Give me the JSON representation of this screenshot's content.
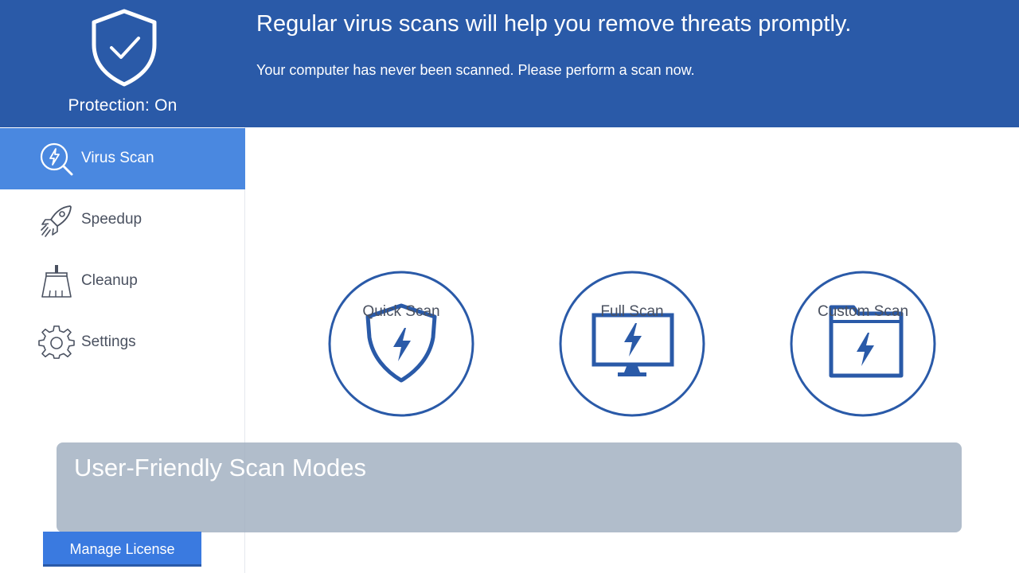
{
  "header": {
    "status_label": "Protection: On",
    "headline": "Regular virus scans will help you remove threats promptly.",
    "subline": "Your computer has never been scanned. Please perform a scan now."
  },
  "sidebar": {
    "items": [
      {
        "label": "Virus Scan",
        "icon": "virus-scan-icon",
        "active": true
      },
      {
        "label": "Speedup",
        "icon": "rocket-icon",
        "active": false
      },
      {
        "label": "Cleanup",
        "icon": "broom-icon",
        "active": false
      },
      {
        "label": "Settings",
        "icon": "gear-icon",
        "active": false
      }
    ],
    "manage_license_label": "Manage License"
  },
  "scan_modes": [
    {
      "label": "Quick Scan",
      "icon": "shield-bolt-icon"
    },
    {
      "label": "Full Scan",
      "icon": "monitor-bolt-icon"
    },
    {
      "label": "Custom Scan",
      "icon": "folder-bolt-icon"
    }
  ],
  "caption": {
    "text": "User-Friendly Scan Modes"
  },
  "colors": {
    "header_bg": "#2a5aa8",
    "active_nav_bg": "#4a88e0",
    "icon_blue": "#2a5aa8",
    "button_bg": "#3a7ae0"
  }
}
